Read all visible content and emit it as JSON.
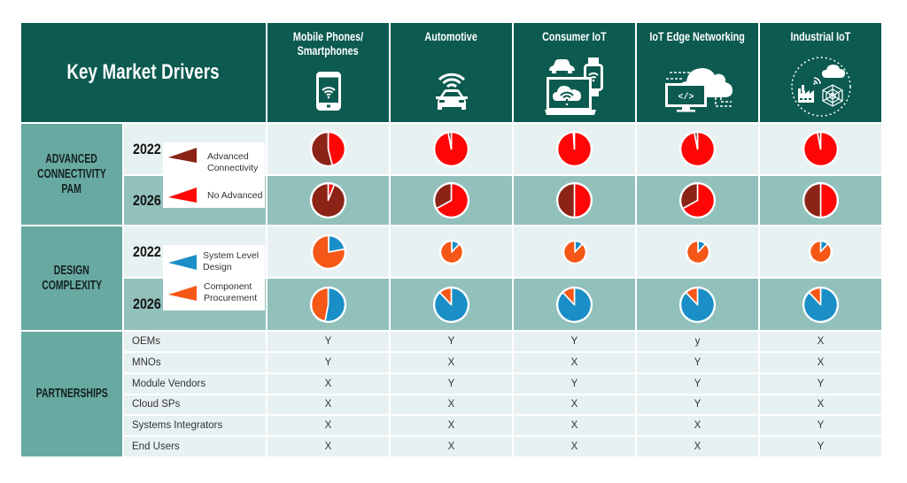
{
  "header": {
    "title": "Key Market Drivers"
  },
  "columns": [
    {
      "label_lines": [
        "Mobile Phones/",
        "Smartphones"
      ],
      "icon": "smartphone-wifi-icon"
    },
    {
      "label_lines": [
        "Automotive"
      ],
      "icon": "connected-car-icon"
    },
    {
      "label_lines": [
        "Consumer IoT"
      ],
      "icon": "consumer-devices-icon"
    },
    {
      "label_lines": [
        "IoT Edge Networking"
      ],
      "icon": "cloud-computer-icon"
    },
    {
      "label_lines": [
        "Industrial IoT"
      ],
      "icon": "industrial-network-icon"
    }
  ],
  "advanced_connectivity": {
    "label_lines": [
      "ADVANCED",
      "CONNECTIVITY",
      "PAM"
    ],
    "years": [
      "2022",
      "2026"
    ],
    "legend": [
      {
        "name": "Advanced Connectivity",
        "label_lines": [
          "Advanced",
          "Connectivity"
        ],
        "color": "#8b2317"
      },
      {
        "name": "No Advanced",
        "label_lines": [
          "No Advanced"
        ],
        "color": "#ff0606"
      }
    ]
  },
  "design_complexity": {
    "label_lines": [
      "DESIGN",
      "COMPLEXITY"
    ],
    "years": [
      "2022",
      "2026"
    ],
    "legend": [
      {
        "name": "System Level Design",
        "label_lines": [
          "System Level",
          "Design"
        ],
        "color": "#1a8ec6"
      },
      {
        "name": "Component Procurement",
        "label_lines": [
          "Component",
          "Procurement"
        ],
        "color": "#f55716"
      }
    ]
  },
  "partnerships": {
    "label": "PARTNERSHIPS",
    "rows": [
      {
        "label": "OEMs",
        "values": [
          "Y",
          "Y",
          "Y",
          "y",
          "X"
        ]
      },
      {
        "label": "MNOs",
        "values": [
          "Y",
          "X",
          "X",
          "Y",
          "X"
        ]
      },
      {
        "label": "Module Vendors",
        "values": [
          "X",
          "Y",
          "Y",
          "Y",
          "Y"
        ]
      },
      {
        "label": "Cloud SPs",
        "values": [
          "X",
          "X",
          "X",
          "Y",
          "X"
        ]
      },
      {
        "label": "Systems Integrators",
        "values": [
          "X",
          "X",
          "X",
          "X",
          "Y"
        ]
      },
      {
        "label": "End Users",
        "values": [
          "X",
          "X",
          "X",
          "X",
          "Y"
        ]
      }
    ]
  },
  "chart_colors": {
    "No Advanced": "#ff0606",
    "Advanced Connectivity": "#8b2317",
    "System Level Design": "#1a8ec6",
    "Component Procurement": "#f55716"
  },
  "chart_data": [
    {
      "type": "pie",
      "section": "Advanced Connectivity PAM",
      "segment": "Mobile Phones/Smartphones",
      "year": "2022",
      "categories": [
        "No Advanced",
        "Advanced Connectivity"
      ],
      "values": [
        46,
        54
      ]
    },
    {
      "type": "pie",
      "section": "Advanced Connectivity PAM",
      "segment": "Automotive",
      "year": "2022",
      "categories": [
        "No Advanced",
        "Advanced Connectivity"
      ],
      "values": [
        97,
        3
      ]
    },
    {
      "type": "pie",
      "section": "Advanced Connectivity PAM",
      "segment": "Consumer IoT",
      "year": "2022",
      "categories": [
        "No Advanced",
        "Advanced Connectivity"
      ],
      "values": [
        99,
        1
      ]
    },
    {
      "type": "pie",
      "section": "Advanced Connectivity PAM",
      "segment": "IoT Edge Networking",
      "year": "2022",
      "categories": [
        "No Advanced",
        "Advanced Connectivity"
      ],
      "values": [
        97,
        3
      ]
    },
    {
      "type": "pie",
      "section": "Advanced Connectivity PAM",
      "segment": "Industrial IoT",
      "year": "2022",
      "categories": [
        "No Advanced",
        "Advanced Connectivity"
      ],
      "values": [
        97,
        3
      ]
    },
    {
      "type": "pie",
      "section": "Advanced Connectivity PAM",
      "segment": "Mobile Phones/Smartphones",
      "year": "2026",
      "categories": [
        "No Advanced",
        "Advanced Connectivity"
      ],
      "values": [
        6,
        94
      ]
    },
    {
      "type": "pie",
      "section": "Advanced Connectivity PAM",
      "segment": "Automotive",
      "year": "2026",
      "categories": [
        "No Advanced",
        "Advanced Connectivity"
      ],
      "values": [
        67,
        33
      ]
    },
    {
      "type": "pie",
      "section": "Advanced Connectivity PAM",
      "segment": "Consumer IoT",
      "year": "2026",
      "categories": [
        "No Advanced",
        "Advanced Connectivity"
      ],
      "values": [
        50,
        50
      ]
    },
    {
      "type": "pie",
      "section": "Advanced Connectivity PAM",
      "segment": "IoT Edge Networking",
      "year": "2026",
      "categories": [
        "No Advanced",
        "Advanced Connectivity"
      ],
      "values": [
        67,
        33
      ]
    },
    {
      "type": "pie",
      "section": "Advanced Connectivity PAM",
      "segment": "Industrial IoT",
      "year": "2026",
      "categories": [
        "No Advanced",
        "Advanced Connectivity"
      ],
      "values": [
        50,
        50
      ]
    },
    {
      "type": "pie",
      "section": "Design Complexity",
      "segment": "Mobile Phones/Smartphones",
      "year": "2022",
      "categories": [
        "System Level Design",
        "Component Procurement"
      ],
      "values": [
        22,
        78
      ]
    },
    {
      "type": "pie",
      "section": "Design Complexity",
      "segment": "Automotive",
      "year": "2022",
      "categories": [
        "System Level Design",
        "Component Procurement"
      ],
      "values": [
        12,
        88
      ]
    },
    {
      "type": "pie",
      "section": "Design Complexity",
      "segment": "Consumer IoT",
      "year": "2022",
      "categories": [
        "System Level Design",
        "Component Procurement"
      ],
      "values": [
        12,
        88
      ]
    },
    {
      "type": "pie",
      "section": "Design Complexity",
      "segment": "IoT Edge Networking",
      "year": "2022",
      "categories": [
        "System Level Design",
        "Component Procurement"
      ],
      "values": [
        12,
        88
      ]
    },
    {
      "type": "pie",
      "section": "Design Complexity",
      "segment": "Industrial IoT",
      "year": "2022",
      "categories": [
        "System Level Design",
        "Component Procurement"
      ],
      "values": [
        12,
        88
      ]
    },
    {
      "type": "pie",
      "section": "Design Complexity",
      "segment": "Mobile Phones/Smartphones",
      "year": "2026",
      "categories": [
        "System Level Design",
        "Component Procurement"
      ],
      "values": [
        53,
        47
      ]
    },
    {
      "type": "pie",
      "section": "Design Complexity",
      "segment": "Automotive",
      "year": "2026",
      "categories": [
        "System Level Design",
        "Component Procurement"
      ],
      "values": [
        88,
        12
      ]
    },
    {
      "type": "pie",
      "section": "Design Complexity",
      "segment": "Consumer IoT",
      "year": "2026",
      "categories": [
        "System Level Design",
        "Component Procurement"
      ],
      "values": [
        88,
        12
      ]
    },
    {
      "type": "pie",
      "section": "Design Complexity",
      "segment": "IoT Edge Networking",
      "year": "2026",
      "categories": [
        "System Level Design",
        "Component Procurement"
      ],
      "values": [
        88,
        12
      ]
    },
    {
      "type": "pie",
      "section": "Design Complexity",
      "segment": "Industrial IoT",
      "year": "2026",
      "categories": [
        "System Level Design",
        "Component Procurement"
      ],
      "values": [
        88,
        12
      ]
    }
  ]
}
